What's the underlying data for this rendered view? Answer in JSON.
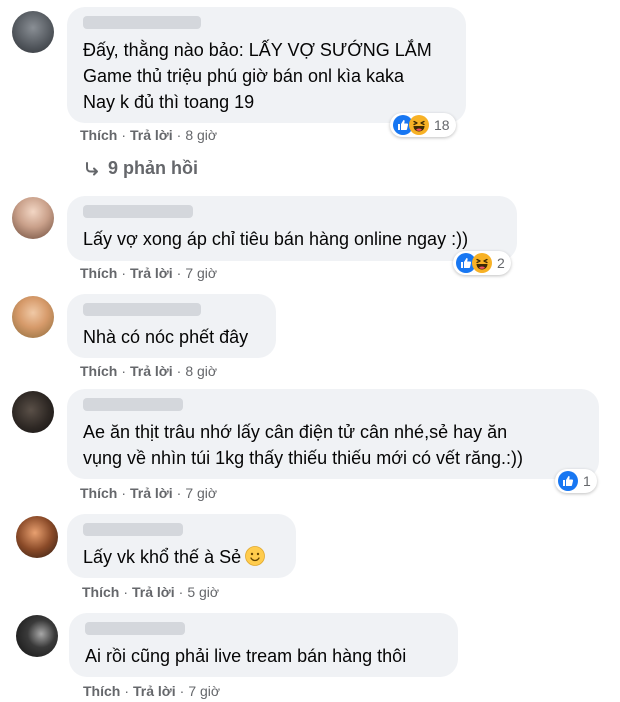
{
  "labels": {
    "like": "Thích",
    "reply": "Trả lời",
    "dot": "·"
  },
  "colors": {
    "like_blue": "#1877f2",
    "haha_yellow": "#f7b125",
    "bubble_bg": "#f0f2f5",
    "meta_gray": "#65676b"
  },
  "comments": [
    {
      "lines": [
        "Đấy, thằng nào bảo: LẤY VỢ SƯỚNG LẮM",
        "Game thủ triệu phú giờ bán onl kìa kaka",
        "Nay k đủ thì toang 19"
      ],
      "time": "8 giờ",
      "reactions": {
        "icons": [
          "like-icon",
          "haha-icon"
        ],
        "count": "18"
      },
      "replies_label": "9 phản hồi"
    },
    {
      "lines": [
        "Lấy vợ xong áp chỉ tiêu bán hàng online ngay :))"
      ],
      "time": "7 giờ",
      "reactions": {
        "icons": [
          "like-icon",
          "haha-icon"
        ],
        "count": "2"
      }
    },
    {
      "lines": [
        "Nhà có nóc phết đây"
      ],
      "time": "8 giờ"
    },
    {
      "lines": [
        "Ae ăn thịt trâu nhớ lấy cân điện tử cân nhé,sẻ hay ăn",
        "vụng về nhìn túi 1kg thấy thiếu thiếu mới có vết răng.:))"
      ],
      "time": "7 giờ",
      "reactions": {
        "icons": [
          "like-icon"
        ],
        "count": "1"
      }
    },
    {
      "lines": [
        "Lấy vk khổ thế à Sẻ"
      ],
      "emoji": "slightly-smiling-face-icon",
      "time": "5 giờ"
    },
    {
      "lines": [
        "Ai rồi cũng phải live tream bán hàng thôi"
      ],
      "time": "7 giờ"
    }
  ]
}
